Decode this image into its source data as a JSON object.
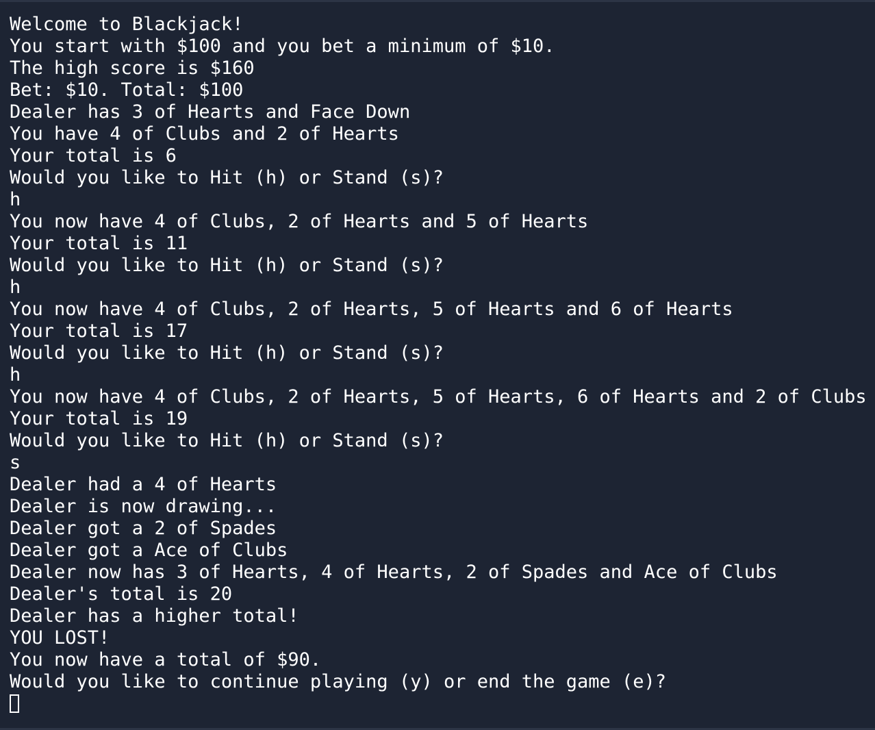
{
  "terminal": {
    "lines": [
      "Welcome to Blackjack!",
      "You start with $100 and you bet a minimum of $10.",
      "The high score is $160",
      "Bet: $10. Total: $100",
      "Dealer has 3 of Hearts and Face Down",
      "You have 4 of Clubs and 2 of Hearts",
      "Your total is 6",
      "Would you like to Hit (h) or Stand (s)?",
      "h",
      "You now have 4 of Clubs, 2 of Hearts and 5 of Hearts",
      "Your total is 11",
      "Would you like to Hit (h) or Stand (s)?",
      "h",
      "You now have 4 of Clubs, 2 of Hearts, 5 of Hearts and 6 of Hearts",
      "Your total is 17",
      "Would you like to Hit (h) or Stand (s)?",
      "h",
      "You now have 4 of Clubs, 2 of Hearts, 5 of Hearts, 6 of Hearts and 2 of Clubs",
      "Your total is 19",
      "Would you like to Hit (h) or Stand (s)?",
      "s",
      "Dealer had a 4 of Hearts",
      "Dealer is now drawing...",
      "Dealer got a 2 of Spades",
      "Dealer got a Ace of Clubs",
      "Dealer now has 3 of Hearts, 4 of Hearts, 2 of Spades and Ace of Clubs",
      "Dealer's total is 20",
      "Dealer has a higher total!",
      "YOU LOST!",
      "You now have a total of $90.",
      "Would you like to continue playing (y) or end the game (e)?"
    ],
    "input_value": ""
  },
  "colors": {
    "background": "#1d2433",
    "text": "#ffffff"
  }
}
